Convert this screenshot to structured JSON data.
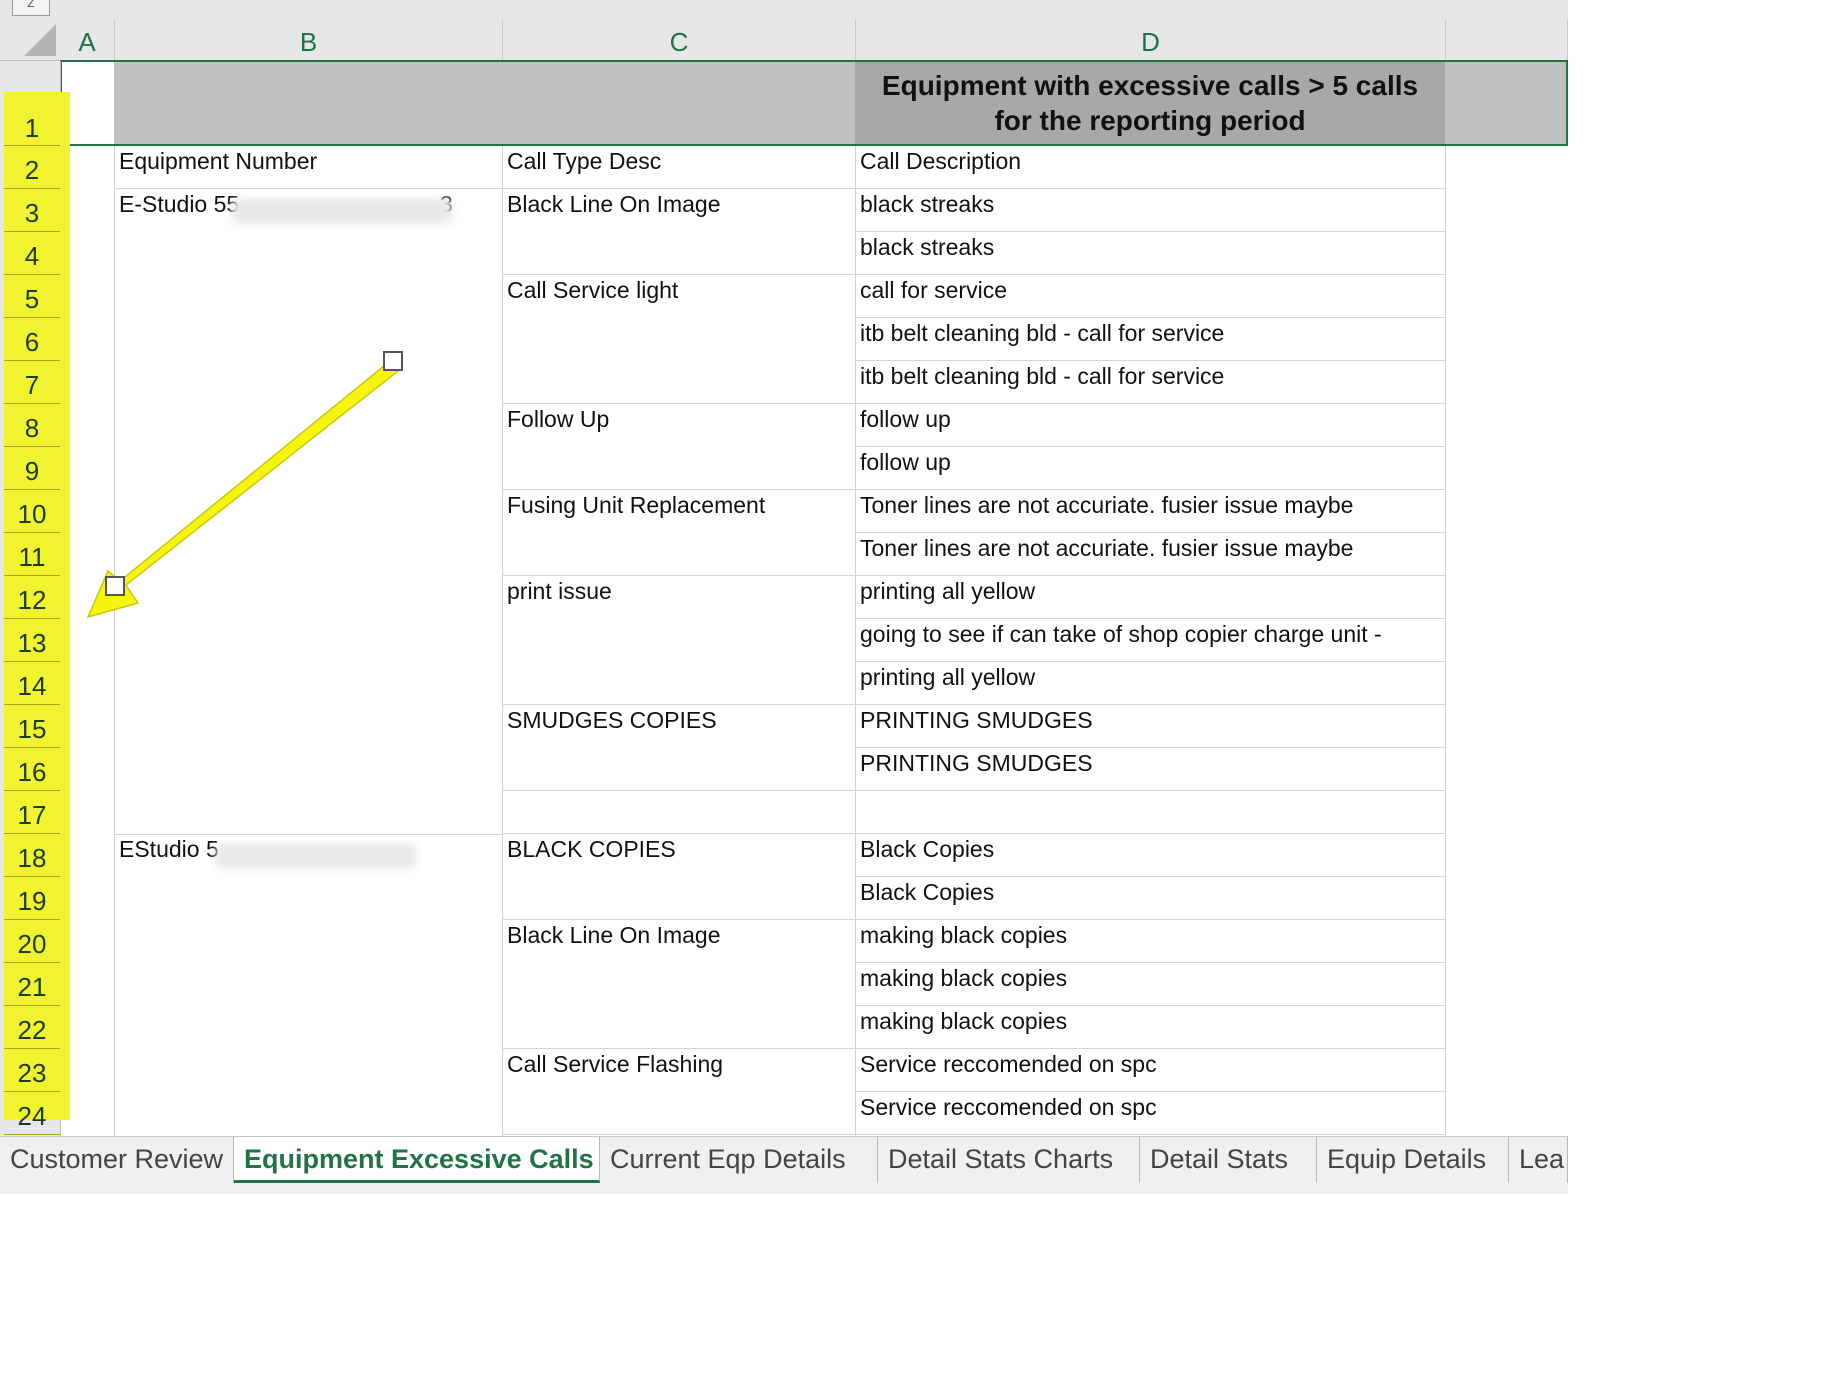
{
  "spreadsheet": {
    "column_headers": [
      "A",
      "B",
      "C",
      "D"
    ],
    "row_numbers": [
      "1",
      "2",
      "3",
      "4",
      "5",
      "6",
      "7",
      "8",
      "9",
      "10",
      "11",
      "12",
      "13",
      "14",
      "15",
      "16",
      "17",
      "18",
      "19",
      "20",
      "21",
      "22",
      "23",
      "24"
    ],
    "title_cell": "Equipment with excessive calls > 5 calls for the reporting period",
    "headers": {
      "equipment_number": "Equipment Number",
      "call_type_desc": "Call Type Desc",
      "call_description": "Call Description"
    },
    "equipment": [
      {
        "label_visible": "E-Studio 55",
        "label_tail": "3"
      },
      {
        "label_visible": "EStudio 5"
      }
    ],
    "call_types": [
      "Black Line On Image",
      "Call Service light",
      "Follow Up",
      "Fusing Unit Replacement",
      "print issue",
      "SMUDGES COPIES",
      "BLACK COPIES",
      "Black Line On Image",
      "Call Service Flashing"
    ],
    "descriptions": [
      "black streaks",
      "black streaks",
      "call for service",
      "itb belt cleaning bld - call for service",
      "itb belt cleaning bld - call for service",
      "follow up",
      "follow up",
      "Toner lines are not accuriate. fusier issue maybe",
      "Toner lines are not accuriate. fusier issue maybe",
      "printing all yellow",
      "going to see if can take of shop copier charge unit -",
      "printing all yellow",
      "PRINTING SMUDGES",
      "PRINTING SMUDGES",
      "",
      "Black Copies",
      "Black Copies",
      "making black copies",
      "making black copies",
      "making black copies",
      "Service reccomended on spc",
      "Service reccomended on spc"
    ]
  },
  "sheet_tabs": [
    "Customer Review",
    "Equipment Excessive Calls",
    "Current Eqp Details",
    "Detail Stats Charts",
    "Detail Stats",
    "Equip Details",
    "Lea"
  ],
  "active_tab": "Equipment Excessive Calls",
  "colors": {
    "excel_green": "#217346",
    "highlight_yellow": "#f1f331",
    "annotation_arrow": "#f5f50f",
    "header_gray": "#a8a8a8"
  }
}
